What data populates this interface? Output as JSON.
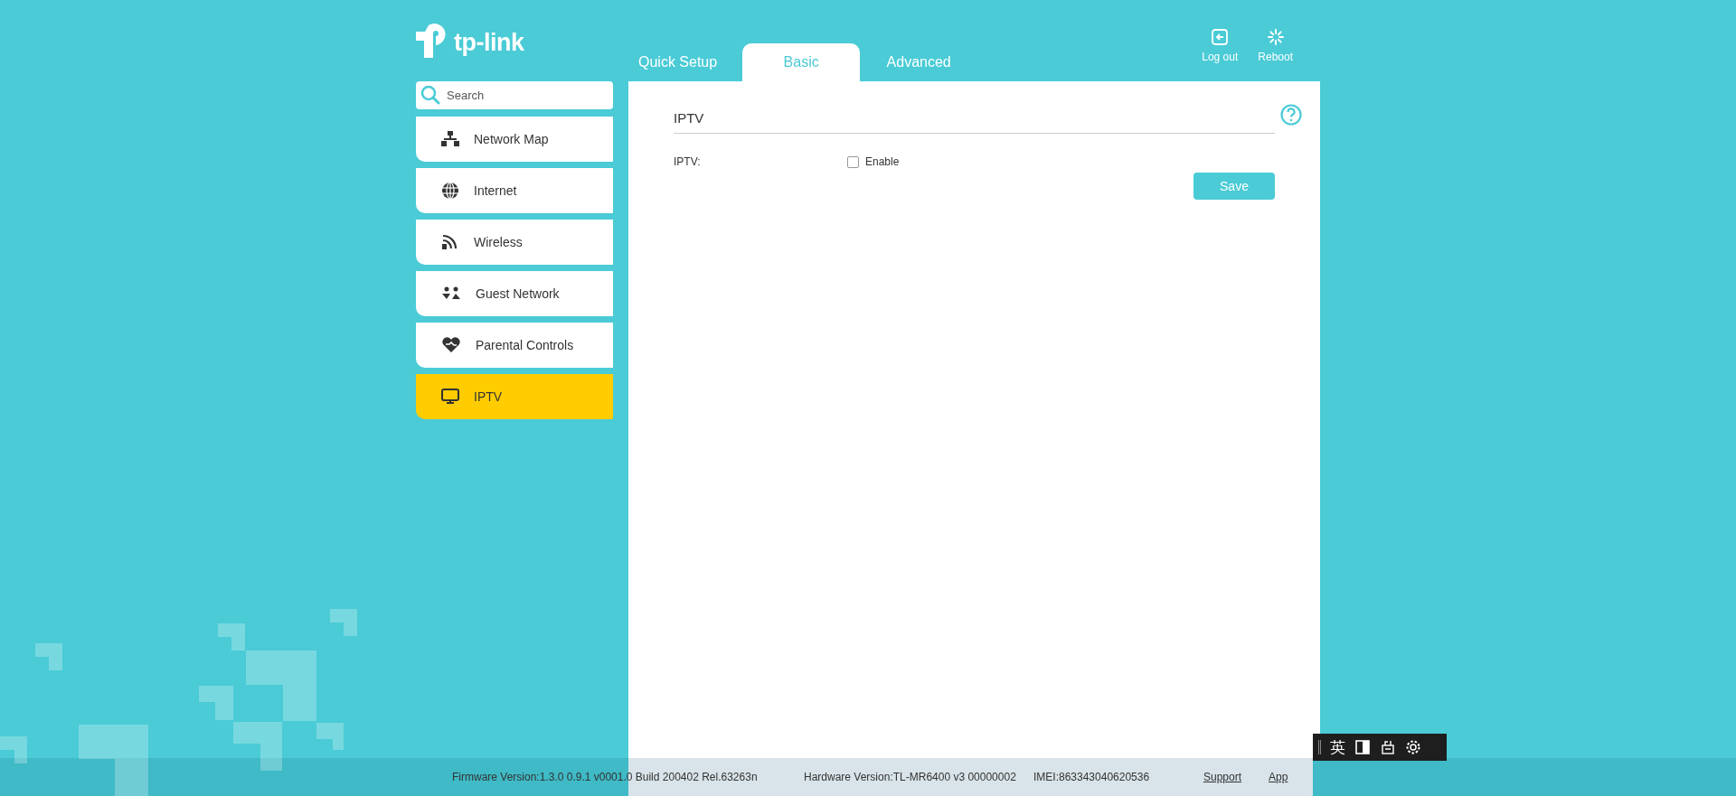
{
  "brand": {
    "name": "tp-link"
  },
  "tabs": [
    {
      "label": "Quick Setup",
      "selected": false
    },
    {
      "label": "Basic",
      "selected": true
    },
    {
      "label": "Advanced",
      "selected": false
    }
  ],
  "header_actions": [
    {
      "kind": "logout",
      "label": "Log out"
    },
    {
      "kind": "reboot",
      "label": "Reboot"
    }
  ],
  "search": {
    "placeholder": "Search"
  },
  "sidebar": {
    "items": [
      {
        "kind": "network",
        "label": "Network Map",
        "selected": false
      },
      {
        "kind": "internet",
        "label": "Internet",
        "selected": false
      },
      {
        "kind": "wireless",
        "label": "Wireless",
        "selected": false
      },
      {
        "kind": "guest",
        "label": "Guest Network",
        "selected": false
      },
      {
        "kind": "parental",
        "label": "Parental Controls",
        "selected": false
      },
      {
        "kind": "iptv",
        "label": "IPTV",
        "selected": true
      }
    ]
  },
  "section": {
    "title": "IPTV",
    "field_label": "IPTV:",
    "checkbox": {
      "label": "Enable",
      "checked": false
    },
    "save": "Save"
  },
  "footer": {
    "firmware": "Firmware Version:1.3.0 0.9.1 v0001.0 Build 200402 Rel.63263n",
    "hardware": "Hardware Version:TL-MR6400 v3 00000002",
    "imei": "IMEI:863343040620536",
    "links": [
      "Support",
      "App"
    ]
  },
  "ime_toolbar": {
    "mode": "英"
  }
}
